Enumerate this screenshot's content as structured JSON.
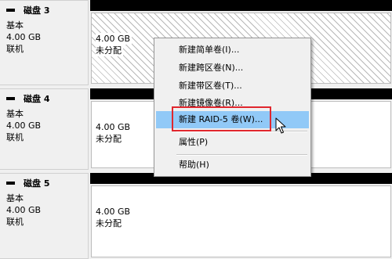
{
  "disks": [
    {
      "name": "磁盘 3",
      "type": "基本",
      "size": "4.00 GB",
      "status": "联机",
      "volume": {
        "size": "4.00 GB",
        "status": "未分配"
      }
    },
    {
      "name": "磁盘 4",
      "type": "基本",
      "size": "4.00 GB",
      "status": "联机",
      "volume": {
        "size": "4.00 GB",
        "status": "未分配"
      }
    },
    {
      "name": "磁盘 5",
      "type": "基本",
      "size": "4.00 GB",
      "status": "联机",
      "volume": {
        "size": "4.00 GB",
        "status": "未分配"
      }
    }
  ],
  "context_menu": {
    "items": [
      "新建简单卷(I)...",
      "新建跨区卷(N)...",
      "新建带区卷(T)...",
      "新建镜像卷(R)...",
      "新建 RAID-5 卷(W)...",
      "属性(P)",
      "帮助(H)"
    ],
    "highlighted_item": "新建 RAID-5 卷(W)..."
  },
  "colors": {
    "highlight": "#91c9f7",
    "annotation_box": "#e0262d",
    "volume_bar": "#000000"
  },
  "icons": [
    "disk-icon",
    "mouse-pointer-icon"
  ]
}
